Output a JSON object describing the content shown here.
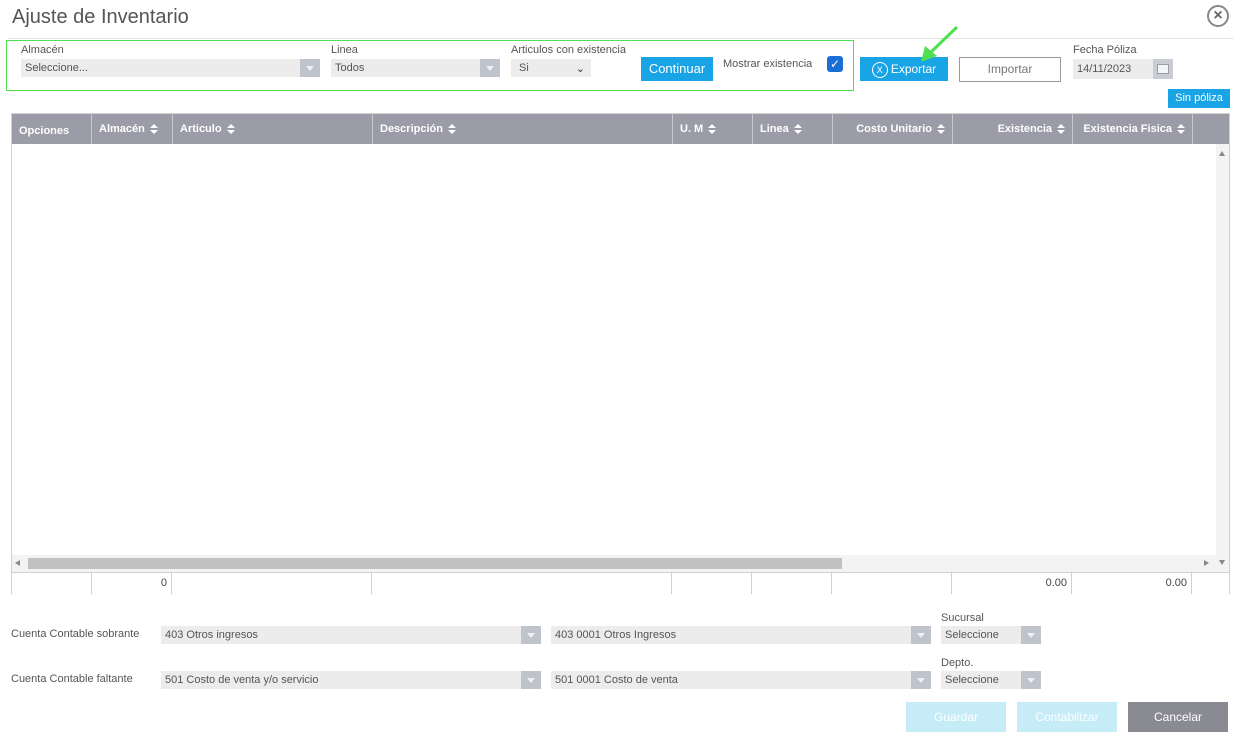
{
  "dialog": {
    "title": "Ajuste de Inventario"
  },
  "filters": {
    "almacen_label": "Almacén",
    "almacen_value": "Seleccione...",
    "linea_label": "Linea",
    "linea_value": "Todos",
    "existencia_label": "Articulos con existencia",
    "existencia_value": "Si",
    "continuar_label": "Continuar",
    "mostrar_label": "Mostrar existencia",
    "mostrar_checked": true
  },
  "toolbar": {
    "exportar_label": "Exportar",
    "importar_label": "Importar",
    "fecha_label": "Fecha Póliza",
    "fecha_value": "14/11/2023",
    "sin_poliza_label": "Sin póliza"
  },
  "grid": {
    "columns": [
      "Opciones",
      "Almacén",
      "Articulo",
      "Descripción",
      "U. M",
      "Linea",
      "Costo Unitario",
      "Existencia",
      "Existencia Fisica"
    ],
    "footer": [
      "",
      "0",
      "",
      "",
      "",
      "",
      "",
      "0.00",
      "0.00"
    ]
  },
  "cuentas": {
    "sobrante_label": "Cuenta Contable sobrante",
    "sobrante_value1": "403 Otros ingresos",
    "sobrante_value2": "403 0001 Otros Ingresos",
    "sucursal_label": "Sucursal",
    "sucursal_value": "Seleccione",
    "faltante_label": "Cuenta Contable faltante",
    "faltante_value1": "501 Costo de venta y/o servicio",
    "faltante_value2": "501 0001 Costo de venta",
    "depto_label": "Depto.",
    "depto_value": "Seleccione"
  },
  "actions": {
    "guardar_label": "Guardar",
    "contabilizar_label": "Contabilizar",
    "cancelar_label": "Cancelar"
  },
  "colors": {
    "accent": "#19a4e6",
    "header": "#9b9ca7",
    "highlight": "#4ee04e"
  }
}
